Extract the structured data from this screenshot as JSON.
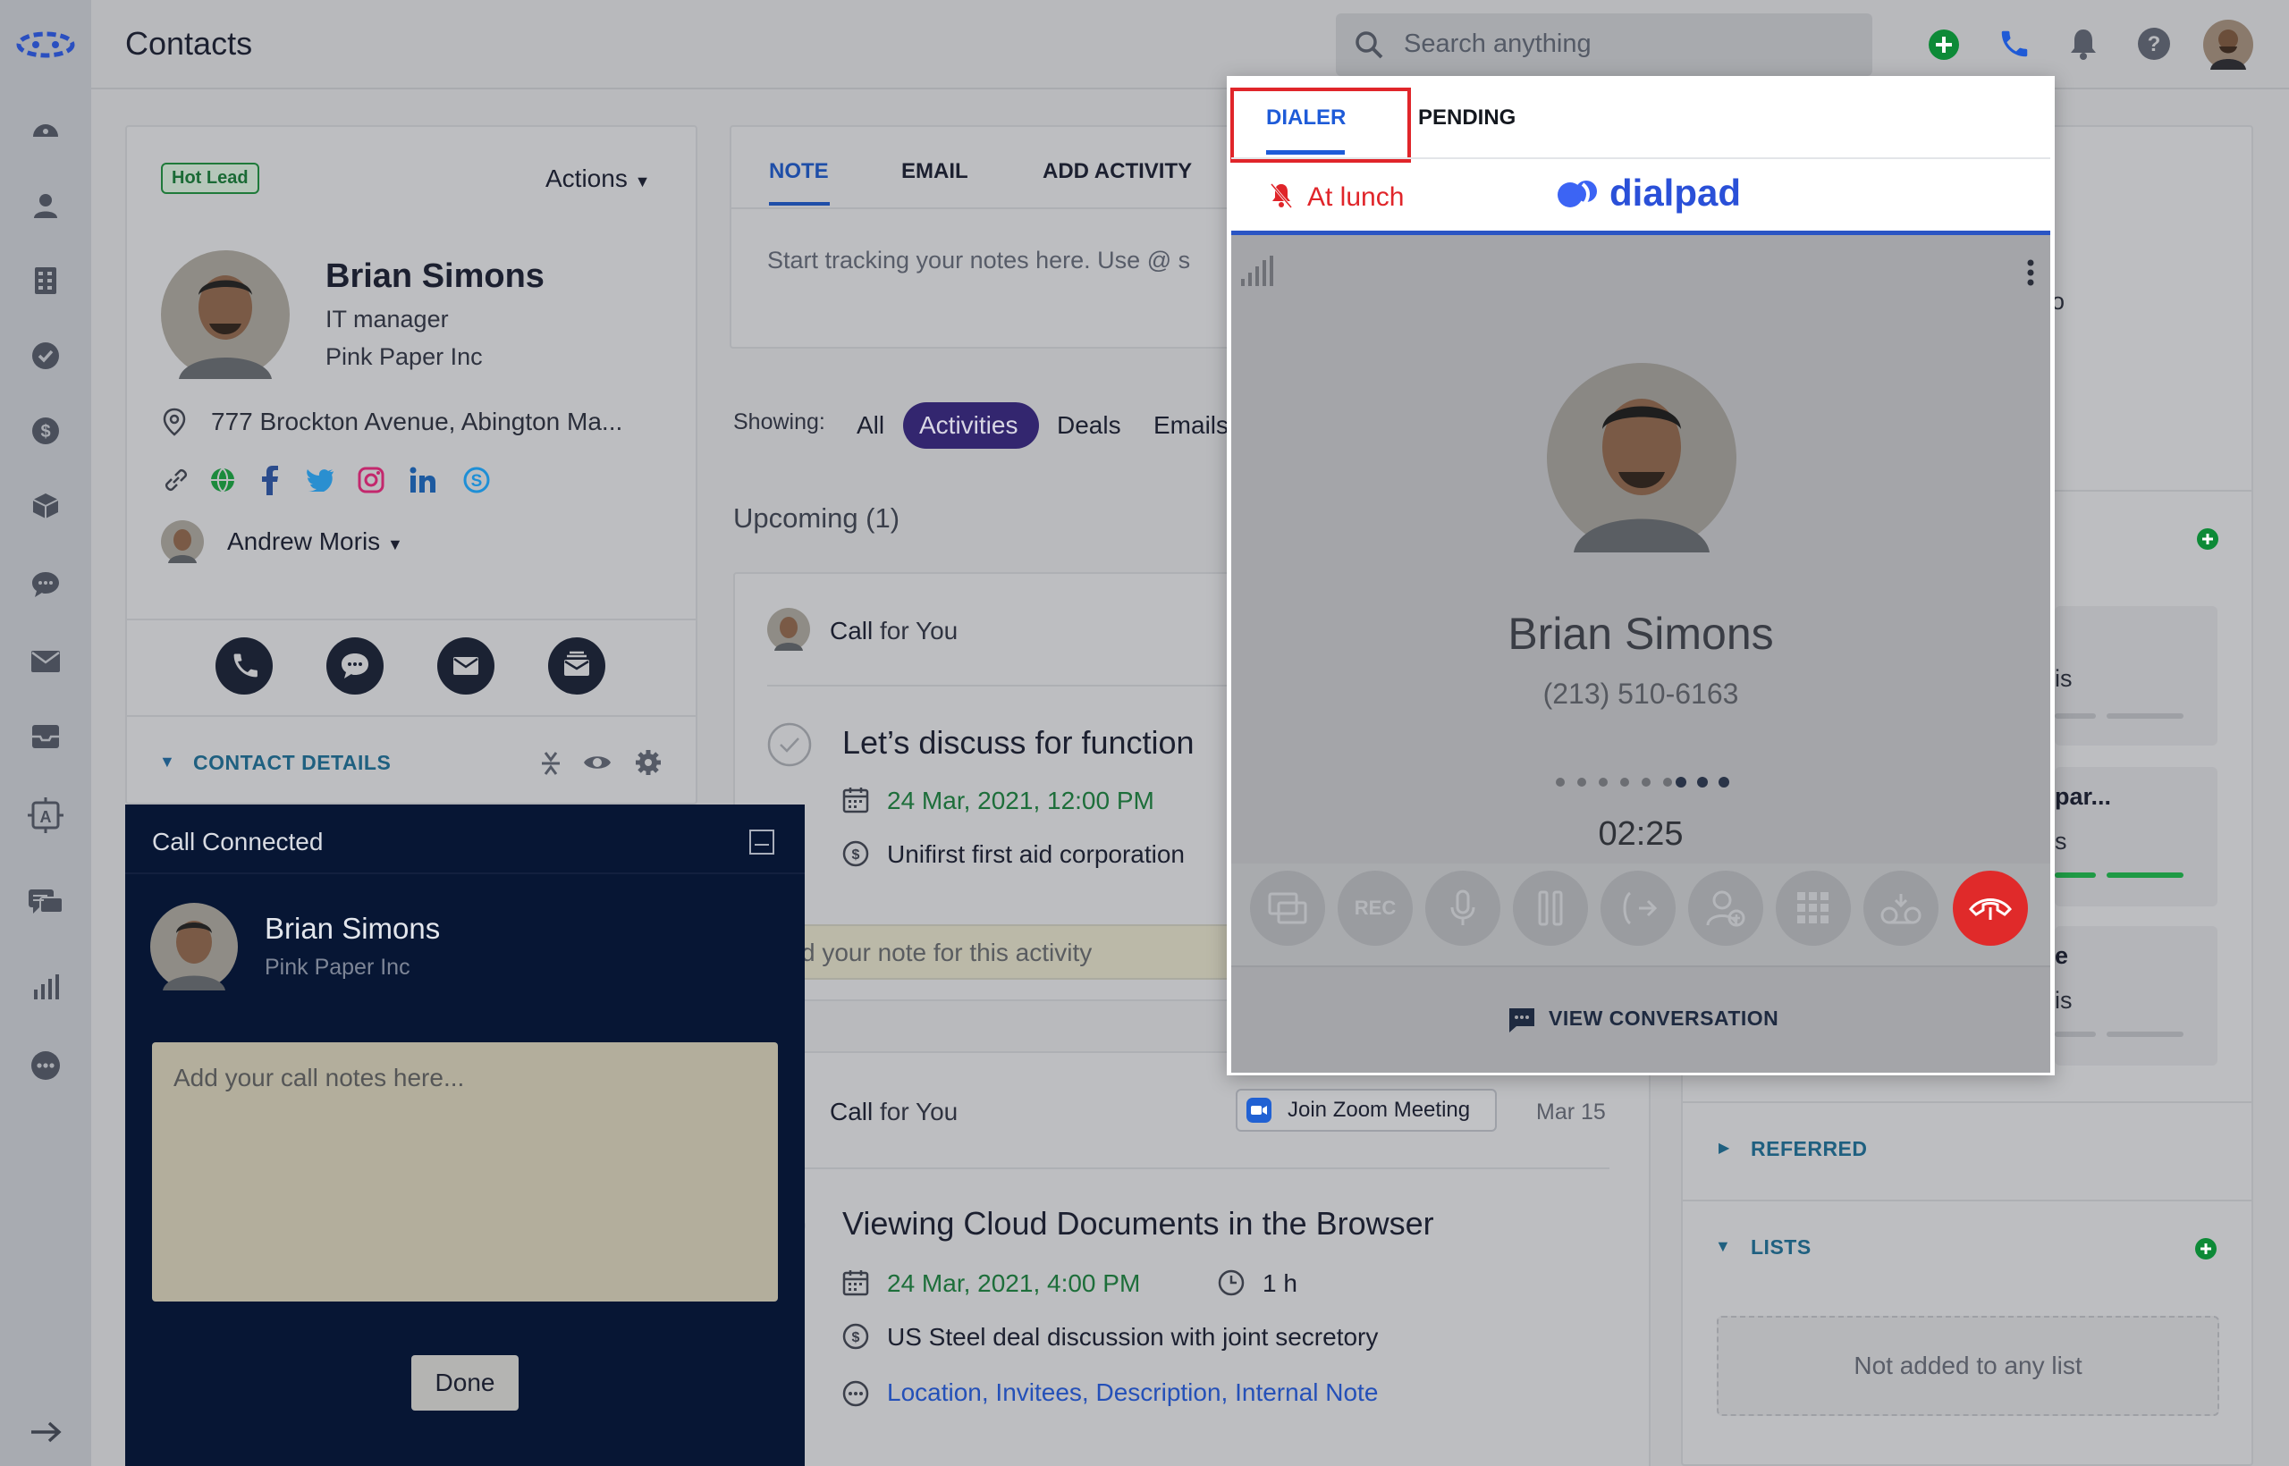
{
  "header": {
    "title": "Contacts",
    "search_placeholder": "Search anything"
  },
  "contact": {
    "badge": "Hot Lead",
    "actions_label": "Actions",
    "name": "Brian Simons",
    "role": "IT manager",
    "company": "Pink Paper Inc",
    "address": "777 Brockton Avenue, Abington Ma...",
    "owner": "Andrew Moris",
    "details_label": "CONTACT DETAILS"
  },
  "composer": {
    "tabs": [
      "NOTE",
      "EMAIL",
      "ADD ACTIVITY"
    ],
    "note_placeholder": "Start tracking your notes here. Use @ s"
  },
  "filters": {
    "label": "Showing:",
    "options": [
      "All",
      "Activities",
      "Deals",
      "Emails"
    ]
  },
  "timeline": {
    "upcoming": "Upcoming (1)",
    "item1": {
      "who": "Call",
      "for_word": "for You",
      "title": "Let’s discuss for function",
      "date": "24 Mar, 2021, 12:00 PM",
      "deal": "Unifirst first aid corporation",
      "note_placeholder": "d your note for this activity"
    },
    "item2": {
      "who": "Call",
      "for_word": "for You",
      "zoom": "Join Zoom Meeting",
      "date_short": "Mar 15",
      "title": "Viewing Cloud Documents in the Browser",
      "date": "24 Mar, 2021, 4:00 PM",
      "duration": "1 h",
      "deal": "US Steel deal discussion with joint secretory",
      "links": "Location, Invitees, Description, Internal Note"
    }
  },
  "right_panel": {
    "partial_1": "o",
    "partial_2": "is",
    "partial_3": "par...",
    "partial_4": "s",
    "partial_5": "e",
    "partial_6": "is",
    "referred": "REFERRED",
    "lists": "LISTS",
    "lists_empty": "Not added to any list"
  },
  "dialer": {
    "tabs": [
      "DIALER",
      "PENDING"
    ],
    "status": "At lunch",
    "brand": "dialpad",
    "name": "Brian Simons",
    "phone": "(213) 510-6163",
    "timer": "02:25",
    "rec_label": "REC",
    "view_conversation": "VIEW CONVERSATION"
  },
  "call_connected": {
    "title": "Call Connected",
    "name": "Brian Simons",
    "company": "Pink Paper Inc",
    "notes_placeholder": "Add your call notes here...",
    "done": "Done"
  },
  "colors": {
    "accent_blue": "#1e5bd8",
    "green": "#0a8a3a",
    "red": "#e0252a",
    "navy": "#071634",
    "purple": "#3b2a8a"
  }
}
